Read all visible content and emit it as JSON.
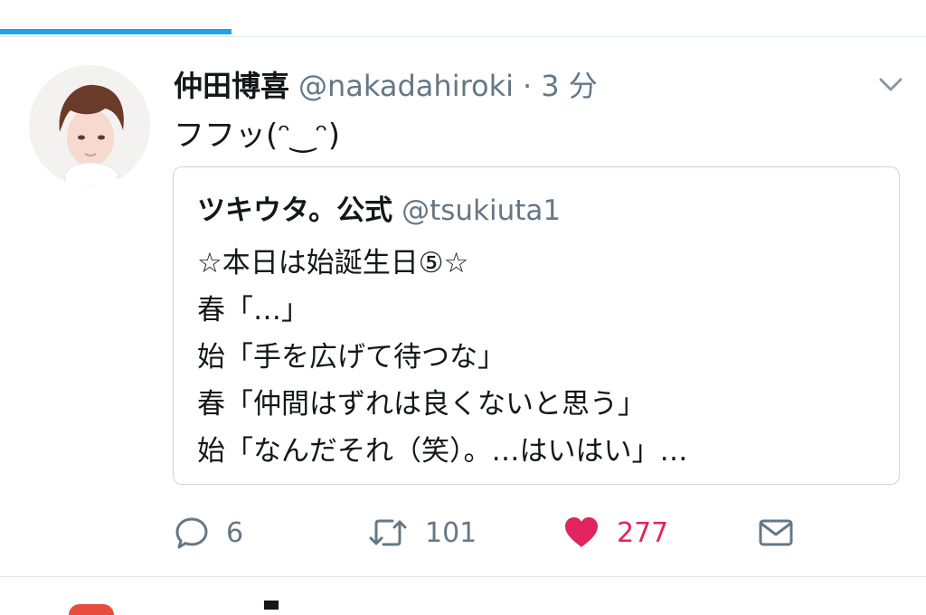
{
  "progress": {
    "fraction": 0.25,
    "color": "#1da1f2"
  },
  "tweet": {
    "author_name": "仲田博喜",
    "author_handle": "@nakadahiroki",
    "separator": "·",
    "time": "3 分",
    "text": "フフッ(ᵔ‿ᵔ)",
    "avatar_icon": "avatar-photo-icon",
    "menu_icon": "chevron-down-icon"
  },
  "quoted": {
    "author_name": "ツキウタ。公式",
    "author_handle": "@tsukiuta1",
    "lines": [
      "☆本日は始誕生日⑤☆",
      "春「…」",
      "始「手を広げて待つな」",
      "春「仲間はずれは良くないと思う」",
      "始「なんだそれ（笑）。…はいはい」…"
    ]
  },
  "actions": {
    "reply": {
      "icon": "reply-icon",
      "count": "6"
    },
    "retweet": {
      "icon": "retweet-icon",
      "count": "101"
    },
    "like": {
      "icon": "heart-icon",
      "count": "277",
      "color": "#e0245e",
      "liked": true
    },
    "message": {
      "icon": "mail-icon"
    }
  },
  "colors": {
    "primary_text": "#14171a",
    "secondary_text": "#657786",
    "accent": "#1da1f2",
    "like": "#e0245e",
    "border": "#ccd6dd"
  }
}
